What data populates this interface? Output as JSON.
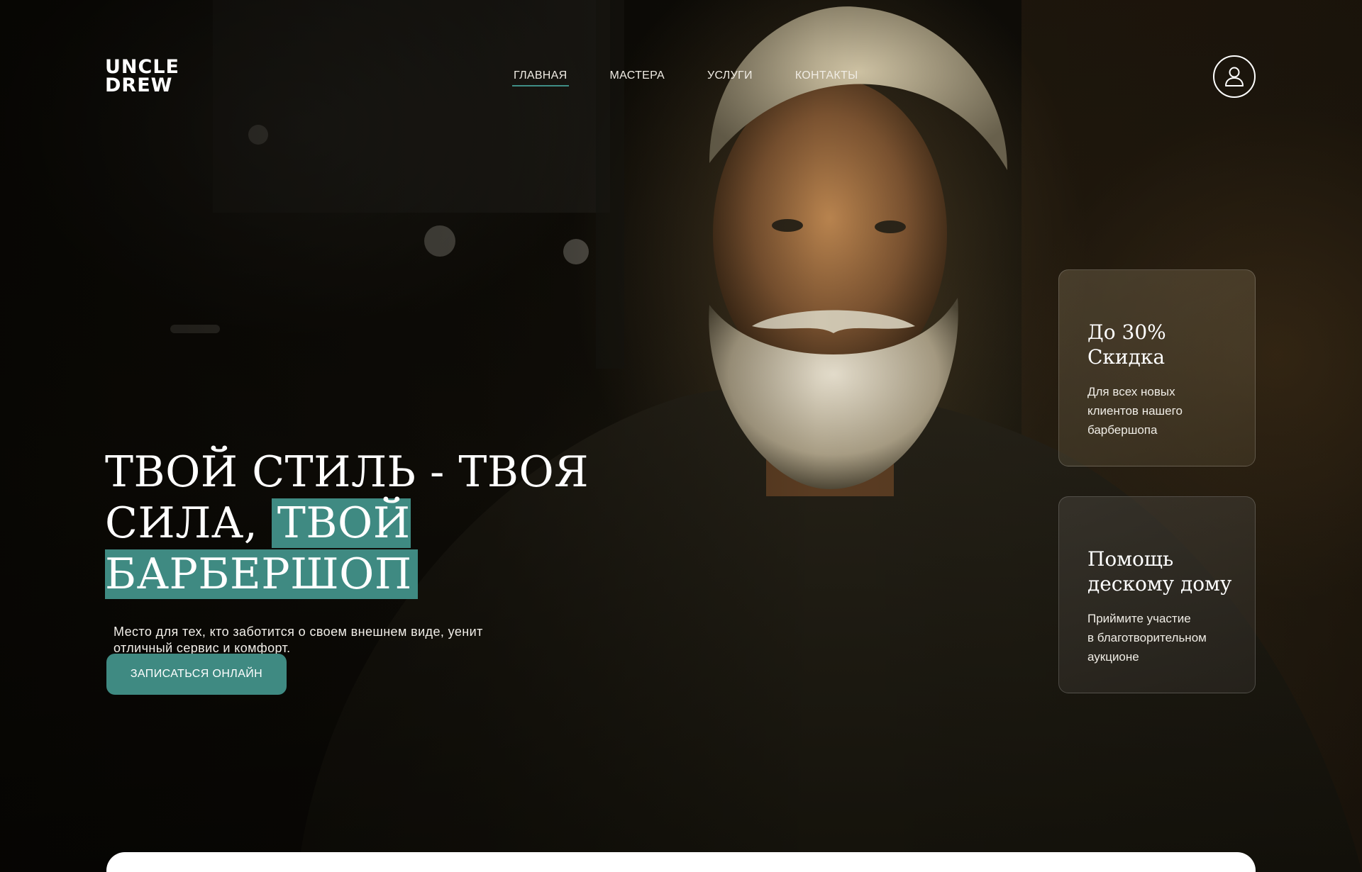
{
  "brand": {
    "logo_line1": "UNCLE",
    "logo_line2": "DREW"
  },
  "nav": {
    "items": [
      {
        "label": "ГЛАВНАЯ",
        "active": true
      },
      {
        "label": "МАСТЕРА",
        "active": false
      },
      {
        "label": "УСЛУГИ",
        "active": false
      },
      {
        "label": "КОНТАКТЫ",
        "active": false
      }
    ]
  },
  "header": {
    "profile_icon": "user-icon"
  },
  "hero": {
    "title_part1": "ТВОЙ СТИЛЬ - ТВОЯ",
    "title_part2": "СИЛА, ",
    "title_highlight": "ТВОЙ БАРБЕРШОП",
    "subtitle": "Место для тех, кто заботится о своем внешнем виде, уенит отличный сервис и комфорт.",
    "cta_label": "ЗАПИСАТЬСЯ ОНЛАЙН"
  },
  "cards": [
    {
      "title_line1": "До 30%",
      "title_line2": "Скидка",
      "text_lines": [
        "Для всех новых",
        "клиентов нашего",
        "барбершопа"
      ]
    },
    {
      "title_line1": "Помощь",
      "title_line2": "дескому дому",
      "text_lines": [
        "Приймите участие",
        "в благотворительном",
        "аукционе"
      ]
    }
  ],
  "colors": {
    "accent": "#3f8a82",
    "background": "#0c0a06",
    "text": "#ffffff"
  }
}
